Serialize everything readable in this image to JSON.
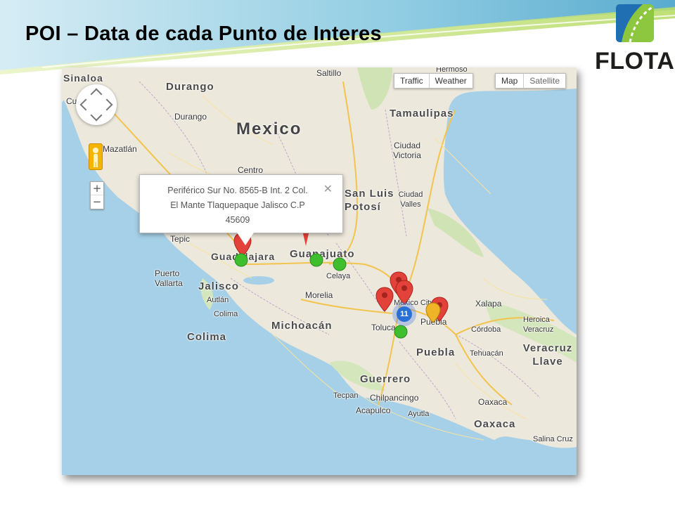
{
  "slide": {
    "title": "POI – Data de cada Punto de Interes",
    "logo_text": "FLOTA"
  },
  "map": {
    "buttons": {
      "traffic": "Traffic",
      "weather": "Weather",
      "map": "Map",
      "satellite": "Satellite"
    },
    "zoom": {
      "in": "+",
      "out": "−"
    },
    "info_window": {
      "lines": [
        "Periférico Sur No. 8565-B Int. 2 Col.",
        "El Mante Tlaquepaque Jalisco C.P",
        "45609"
      ],
      "close": "✕"
    },
    "cluster_count": "11",
    "labels": {
      "country_mexico": "Mexico",
      "sinaloa": "Sinaloa",
      "durango_state": "Durango",
      "durango_city": "Durango",
      "saltillo": "Saltillo",
      "hermosillo_cut": "Hermoso",
      "tamaulipas": "Tamaulipas",
      "ciudad_victoria": "Ciudad Victoria",
      "mazatlan": "Mazatlán",
      "centro": "Centro",
      "san_luis_potosi": "San Luis Potosí",
      "ciudad_valles": "Ciudad Valles",
      "tepic": "Tepic",
      "guadalajara": "Guadalajara",
      "guanajuato": "Guanajuato",
      "celaya": "Celaya",
      "puerto_vallarta": "Puerto Vallarta",
      "jalisco": "Jalisco",
      "morelia": "Morelia",
      "autlan": "Autlán",
      "colima_city": "Colima",
      "colima_state": "Colima",
      "michoacan": "Michoacán",
      "toluca": "Toluca",
      "mexico_city": "México City",
      "puebla_city": "Puebla",
      "puebla_state": "Puebla",
      "xalapa": "Xalapa",
      "heroica_veracruz": "Heroica Veracruz",
      "cordoba": "Córdoba",
      "veracruz_llave": "Veracruz Llave",
      "tehuacan": "Tehuacán",
      "guerrero": "Guerrero",
      "chilpancingo": "Chilpancingo",
      "tecpan": "Tecpan",
      "acapulco": "Acapulco",
      "ayutla": "Ayutla",
      "oaxaca_city": "Oaxaca",
      "oaxaca_state": "Oaxaca",
      "salina_cruz": "Salina Cruz",
      "culiacan_cut": "Cu"
    }
  },
  "colors": {
    "water": "#a6d0e7",
    "land": "#ede8dc",
    "marker_red": "#e3423a",
    "marker_green": "#3fbf2e",
    "cluster_blue": "#2a6fd6",
    "logo_green": "#8dc63f",
    "logo_blue": "#1f6fb2"
  },
  "icons": {
    "pan_control": "pan-arrows-icon",
    "pegman": "street-view-pegman-icon",
    "close": "close-icon",
    "marker": "map-pin-icon"
  }
}
